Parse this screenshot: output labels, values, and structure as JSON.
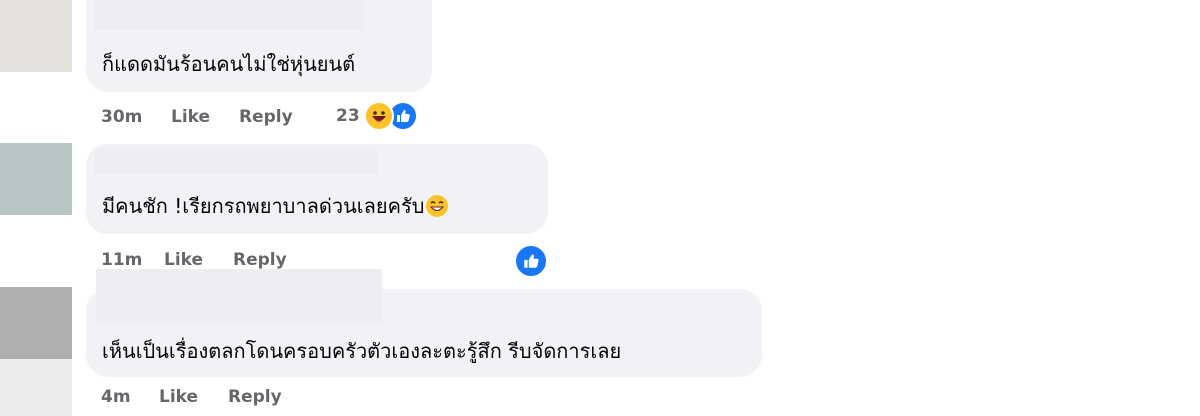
{
  "comments": [
    {
      "text": "ก็แดดมันร้อนคนไม่ใช่หุ่นยนต์",
      "time": "30m",
      "like_label": "Like",
      "reply_label": "Reply",
      "reaction_count": "23",
      "reactions": [
        "haha-emoji",
        "like-icon"
      ],
      "avatar_color": "#e4e0dc"
    },
    {
      "text": "มีคนชัก !เรียกรถพยาบาลด่วนเลยครับ",
      "inline_emoji": "grinning-emoji",
      "time": "11m",
      "like_label": "Like",
      "reply_label": "Reply",
      "reactions": [
        "like-icon"
      ],
      "avatar_color": "#b8c6c6"
    },
    {
      "text": "เห็นเป็นเรื่องตลกโดนครอบครัวตัวเองละตะรู้สึก รีบจัดการเลย",
      "time": "4m",
      "like_label": "Like",
      "reply_label": "Reply",
      "avatar_color": "#afafaf"
    }
  ],
  "colors": {
    "bubble": "#f0f2f5",
    "meta_text": "#65676b",
    "like_blue": "#1877f2",
    "haha_yellow": "#fcc22a"
  }
}
